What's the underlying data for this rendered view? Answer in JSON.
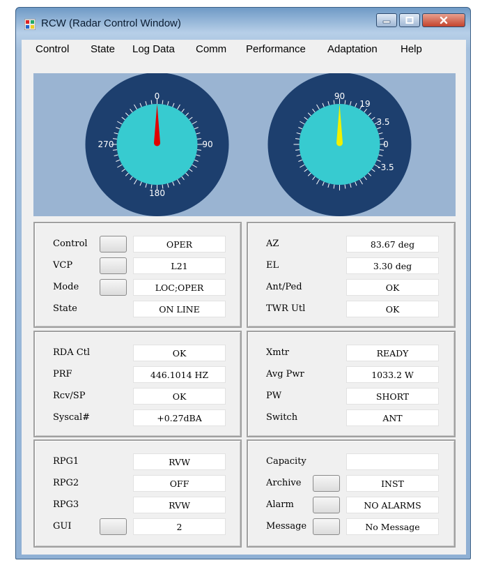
{
  "window": {
    "title": "RCW (Radar Control Window)"
  },
  "menu": [
    "Control",
    "State",
    "Log Data",
    "Comm",
    "Performance",
    "Adaptation",
    "Help"
  ],
  "gauges": {
    "azimuth": {
      "labels": [
        "0",
        "90",
        "180",
        "270"
      ],
      "value_deg": 0,
      "needle_color": "#e00000"
    },
    "elevation": {
      "labels": [
        "90",
        "19",
        "3.5",
        "0",
        "-3.5"
      ],
      "value_deg": 90,
      "needle_color": "#f0f000"
    },
    "colors": {
      "dial_outer": "#1d3f6e",
      "dial_face": "#37cbd0",
      "background": "#9ab4d2"
    }
  },
  "panels": {
    "status": [
      {
        "label": "Control",
        "button": true,
        "value": "OPER"
      },
      {
        "label": "VCP",
        "button": true,
        "value": "L21"
      },
      {
        "label": "Mode",
        "button": true,
        "value": "LOC;OPER"
      },
      {
        "label": "State",
        "button": false,
        "value": "ON LINE"
      }
    ],
    "antenna": [
      {
        "label": "AZ",
        "button": false,
        "value": "83.67 deg"
      },
      {
        "label": "EL",
        "button": false,
        "value": "3.30 deg"
      },
      {
        "label": "Ant/Ped",
        "button": false,
        "value": "OK"
      },
      {
        "label": "TWR Utl",
        "button": false,
        "value": "OK"
      }
    ],
    "rda": [
      {
        "label": "RDA Ctl",
        "button": false,
        "value": "OK"
      },
      {
        "label": "PRF",
        "button": false,
        "value": "446.1014 HZ"
      },
      {
        "label": "Rcv/SP",
        "button": false,
        "value": "OK"
      },
      {
        "label": "Syscal#",
        "button": false,
        "value": "+0.27dBA"
      }
    ],
    "transmitter": [
      {
        "label": "Xmtr",
        "button": false,
        "value": "READY"
      },
      {
        "label": "Avg Pwr",
        "button": false,
        "value": "1033.2 W"
      },
      {
        "label": "PW",
        "button": false,
        "value": "SHORT"
      },
      {
        "label": "Switch",
        "button": false,
        "value": "ANT"
      }
    ],
    "rpg": [
      {
        "label": "RPG1",
        "button": false,
        "value": "RVW"
      },
      {
        "label": "RPG2",
        "button": false,
        "value": "OFF"
      },
      {
        "label": "RPG3",
        "button": false,
        "value": "RVW"
      },
      {
        "label": "GUI",
        "button": true,
        "value": "2"
      }
    ],
    "system": [
      {
        "label": "Capacity",
        "button": false,
        "value": ""
      },
      {
        "label": "Archive",
        "button": true,
        "value": "INST"
      },
      {
        "label": "Alarm",
        "button": true,
        "value": "NO ALARMS"
      },
      {
        "label": "Message",
        "button": true,
        "value": "No Message"
      }
    ]
  }
}
